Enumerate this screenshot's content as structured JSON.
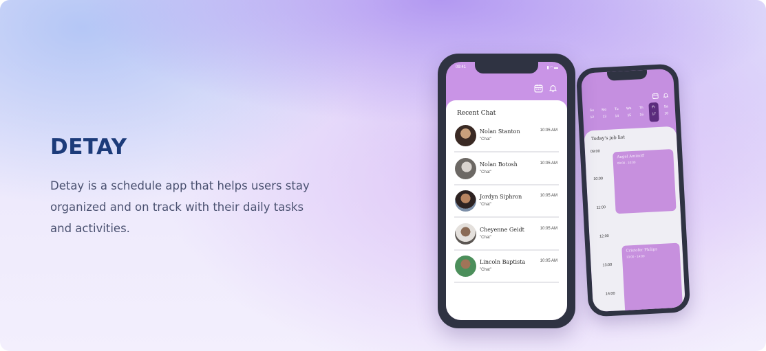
{
  "hero": {
    "title": "DETAY",
    "description": "Detay is a schedule app that helps users stay organized and on track with their daily tasks and activities."
  },
  "chat_phone": {
    "status_time": "09:41",
    "header_icons": [
      "calendar-icon",
      "bell-icon"
    ],
    "section_title": "Recent Chat",
    "chats": [
      {
        "name": "Nolan Stanton",
        "message": "\"Chat\"",
        "time": "10:05 AM"
      },
      {
        "name": "Nolan Botosh",
        "message": "\"Chat\"",
        "time": "10:05 AM"
      },
      {
        "name": "Jordyn Siphron",
        "message": "\"Chat\"",
        "time": "10:05 AM"
      },
      {
        "name": "Cheyenne Geidt",
        "message": "\"Chat\"",
        "time": "10:05 AM"
      },
      {
        "name": "Lincoln Baptista",
        "message": "\"Chat\"",
        "time": "10:05 AM"
      }
    ]
  },
  "schedule_phone": {
    "header_icons": [
      "calendar-icon",
      "bell-icon"
    ],
    "days": [
      {
        "label": "Su",
        "date": "12"
      },
      {
        "label": "Mo",
        "date": "13"
      },
      {
        "label": "Tu",
        "date": "14"
      },
      {
        "label": "We",
        "date": "15"
      },
      {
        "label": "Th",
        "date": "16"
      },
      {
        "label": "Fr",
        "date": "17"
      },
      {
        "label": "Sa",
        "date": "18"
      }
    ],
    "active_day_index": 5,
    "section_title": "Today's job list",
    "times": [
      "09:00",
      "10:00",
      "11:00",
      "12:00",
      "13:00",
      "14:00"
    ],
    "events": [
      {
        "name": "Angel Aminoff",
        "time": "09:00 - 10:00"
      },
      {
        "name": "Cristofer Philips",
        "time": "13:00 - 14:00"
      }
    ]
  },
  "colors": {
    "brand_title": "#1c3b7a",
    "phone_frame": "#2f3342",
    "accent_purple": "#c994e6"
  }
}
